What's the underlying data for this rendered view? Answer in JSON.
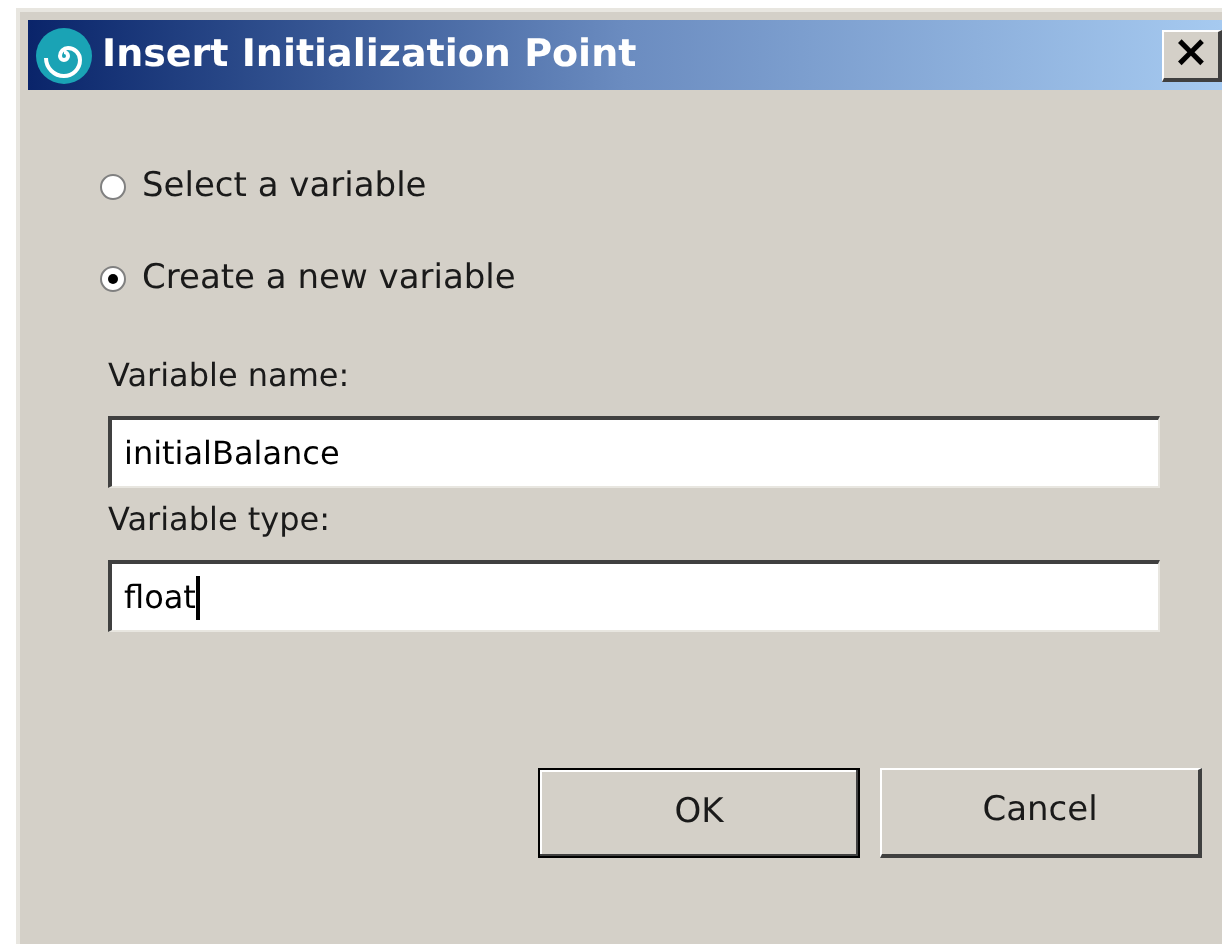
{
  "window": {
    "title": "Insert Initialization Point",
    "close": "×"
  },
  "options": [
    {
      "label": "Select a variable",
      "selected": false
    },
    {
      "label": "Create a new variable",
      "selected": true
    }
  ],
  "fields": [
    {
      "label": "Variable name:",
      "value": "initialBalance",
      "focused": false
    },
    {
      "label": "Variable type:",
      "value": "float",
      "focused": true
    }
  ],
  "buttons": [
    {
      "label": "OK",
      "default": true
    },
    {
      "label": "Cancel",
      "default": false
    }
  ]
}
